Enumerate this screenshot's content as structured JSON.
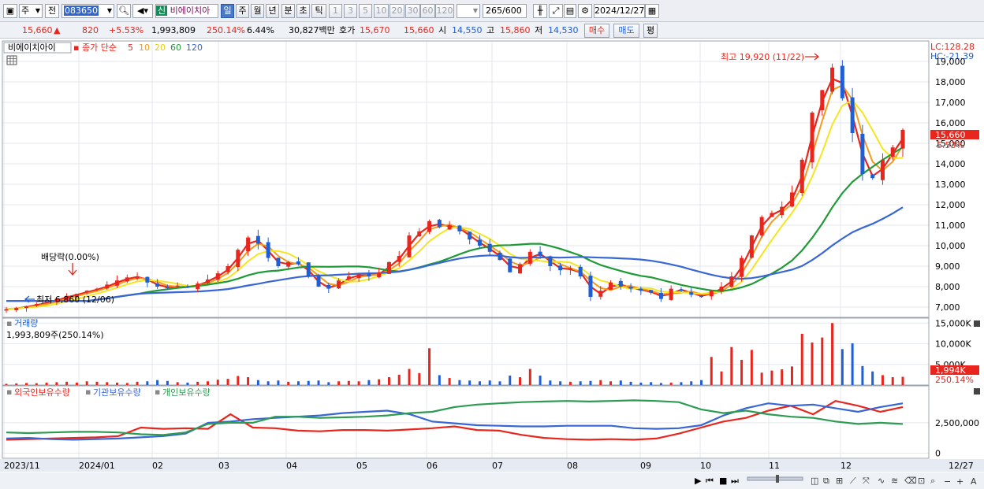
{
  "toolbar": {
    "type_select": "주",
    "prev_label": "전",
    "code_value": "083650",
    "shin_badge": "신",
    "stock_name": "비에이치아",
    "period_buttons": [
      "일",
      "주",
      "월",
      "년",
      "분",
      "초",
      "틱"
    ],
    "interval_buttons": [
      "1",
      "3",
      "5",
      "10",
      "20",
      "30",
      "60",
      "120"
    ],
    "count_value": "265",
    "count_max": "/600",
    "date_value": "2024/12/27"
  },
  "quote": {
    "price": "15,660",
    "change": "820",
    "change_pct": "+5.53%",
    "volume": "1,993,809",
    "volume_ratio": "250.14%",
    "turnover": "6.44%",
    "amount": "30,827백만",
    "ask_label": "호가",
    "ask1": "15,670",
    "ask2": "15,660",
    "open_label": "시",
    "open": "14,550",
    "high_label": "고",
    "high": "15,860",
    "low_label": "저",
    "low": "14,530",
    "buy_button": "매수",
    "sell_button": "매도",
    "eval_button": "평"
  },
  "price_panel": {
    "title": "비에이치아이",
    "ma_label": "종가 단순",
    "ma_periods": [
      "5",
      "10",
      "20",
      "60",
      "120"
    ],
    "lc_label": "LC:128.28",
    "hc_label": "HC:-21.39",
    "high_annotation": "최고 19,920 (11/22)",
    "low_annotation": "최저 6,860 (12/06)",
    "dividend_annotation": "배당락(0.00%)",
    "current_price_tag": "15,660",
    "current_pct_tag": "5.53%",
    "y_ticks": [
      "19,000",
      "18,000",
      "17,000",
      "16,000",
      "15,000",
      "14,000",
      "13,000",
      "12,000",
      "11,000",
      "10,000",
      "9,000",
      "8,000",
      "7,000"
    ]
  },
  "volume_panel": {
    "title": "거래량",
    "value_label": "1,993,809주(250.14%)",
    "y_ticks": [
      "15,000K",
      "10,000K",
      "5,000K"
    ],
    "current_tag": "1,994K",
    "current_pct_tag": "250.14%"
  },
  "holding_panel": {
    "legend": [
      "외국인보유수량",
      "기관보유수량",
      "개인보유수량"
    ],
    "y_ticks": [
      "2,500,000",
      "0"
    ]
  },
  "x_axis": {
    "labels": [
      "2023/11",
      "2024/01",
      "02",
      "03",
      "04",
      "05",
      "06",
      "07",
      "08",
      "09",
      "10",
      "11",
      "12",
      "12/27"
    ]
  },
  "colors": {
    "up": "#e8261d",
    "down": "#1f5fd6",
    "ma5": "#e8261d",
    "ma10": "#f39a1c",
    "ma20": "#f5e521",
    "ma60": "#1f9a36",
    "ma120": "#3866d4",
    "foreign": "#e8261d",
    "institution": "#3866d4",
    "individual": "#2e9a52"
  },
  "chart_data": [
    {
      "type": "candlestick",
      "title": "비에이치아이",
      "x": [
        "2023/11",
        "2024/01",
        "02",
        "03",
        "04",
        "05",
        "06",
        "07",
        "08",
        "09",
        "10",
        "11",
        "12",
        "12/27"
      ],
      "ylim": [
        6500,
        20000
      ],
      "series_close_approx": [
        6900,
        6960,
        7050,
        7150,
        7250,
        7400,
        7550,
        7650,
        7800,
        7900,
        8100,
        8300,
        8450,
        8500,
        8200,
        8000,
        7950,
        8050,
        7950,
        8150,
        8350,
        8650,
        9000,
        9800,
        10400,
        10100,
        9400,
        9000,
        9200,
        9100,
        8500,
        8000,
        7900,
        8300,
        8500,
        8600,
        8500,
        8700,
        9200,
        9500,
        10500,
        10700,
        11200,
        10900,
        11000,
        10700,
        10300,
        10000,
        9700,
        9300,
        8700,
        9100,
        9700,
        9500,
        9000,
        8800,
        8900,
        8500,
        7500,
        7800,
        8200,
        8000,
        7900,
        7800,
        7700,
        7400,
        7900,
        7800,
        7600,
        7500,
        7800,
        8000,
        8500,
        9400,
        10500,
        11400,
        11600,
        11900,
        12600,
        14200,
        16500,
        17600,
        18700,
        17200,
        15500,
        13500,
        13300,
        14200,
        14800,
        15660
      ],
      "ma_periods": [
        5,
        10,
        20,
        60,
        120
      ]
    },
    {
      "type": "bar",
      "title": "거래량",
      "ylim": [
        0,
        16000000
      ],
      "values_k": [
        300,
        400,
        500,
        450,
        600,
        700,
        800,
        600,
        900,
        800,
        700,
        600,
        500,
        800,
        900,
        1200,
        1000,
        700,
        600,
        800,
        900,
        1300,
        1500,
        2200,
        1900,
        1200,
        900,
        1100,
        800,
        900,
        1000,
        1100,
        700,
        900,
        1000,
        900,
        1200,
        1400,
        1900,
        2500,
        3900,
        2900,
        8900,
        2400,
        1700,
        1200,
        1100,
        900,
        1100,
        900,
        2300,
        1900,
        3900,
        2300,
        1100,
        900,
        800,
        900,
        1000,
        1200,
        900,
        1100,
        800,
        600,
        700,
        500,
        600,
        700,
        900,
        1200,
        6800,
        3300,
        9200,
        6100,
        8500,
        3000,
        3500,
        3800,
        4500,
        12400,
        10300,
        11500,
        15000,
        8700,
        10100,
        4600,
        3300,
        2400,
        1900,
        1994
      ]
    },
    {
      "type": "line",
      "title": "보유수량",
      "series": [
        {
          "name": "외국인보유수량",
          "values": [
            1100000,
            1150000,
            1200000,
            1250000,
            1300000,
            1400000,
            2100000,
            2000000,
            2050000,
            2000000,
            3200000,
            2100000,
            2050000,
            1850000,
            1800000,
            1900000,
            1900000,
            1850000,
            1950000,
            2050000,
            2200000,
            1900000,
            1850000,
            1500000,
            1250000,
            1150000,
            1100000,
            1150000,
            1100000,
            1200000,
            1600000,
            2100000,
            2600000,
            2900000,
            3500000,
            3900000,
            3200000,
            4300000,
            3900000,
            3400000,
            3800000
          ]
        },
        {
          "name": "기관보유수량",
          "values": [
            1200000,
            1250000,
            1150000,
            1100000,
            1150000,
            1200000,
            1300000,
            1400000,
            1600000,
            2500000,
            2600000,
            2800000,
            2900000,
            3000000,
            3100000,
            3300000,
            3400000,
            3500000,
            3200000,
            2600000,
            2450000,
            2300000,
            2250000,
            2200000,
            2200000,
            2250000,
            2250000,
            2250000,
            2050000,
            2000000,
            2050000,
            2300000,
            3100000,
            3700000,
            4100000,
            3900000,
            4000000,
            3700000,
            3400000,
            3800000,
            4100000
          ]
        },
        {
          "name": "개인보유수량",
          "values": [
            1700000,
            1650000,
            1700000,
            1750000,
            1750000,
            1700000,
            1550000,
            1500000,
            1700000,
            2400000,
            2500000,
            2500000,
            3000000,
            3000000,
            2900000,
            2950000,
            3000000,
            3100000,
            3300000,
            3400000,
            3800000,
            4000000,
            4100000,
            4200000,
            4250000,
            4300000,
            4250000,
            4300000,
            4350000,
            4300000,
            4200000,
            3600000,
            3300000,
            3500000,
            3200000,
            3000000,
            2900000,
            2600000,
            2400000,
            2500000,
            2400000
          ]
        }
      ],
      "ylim": [
        -300000,
        4700000
      ]
    }
  ]
}
